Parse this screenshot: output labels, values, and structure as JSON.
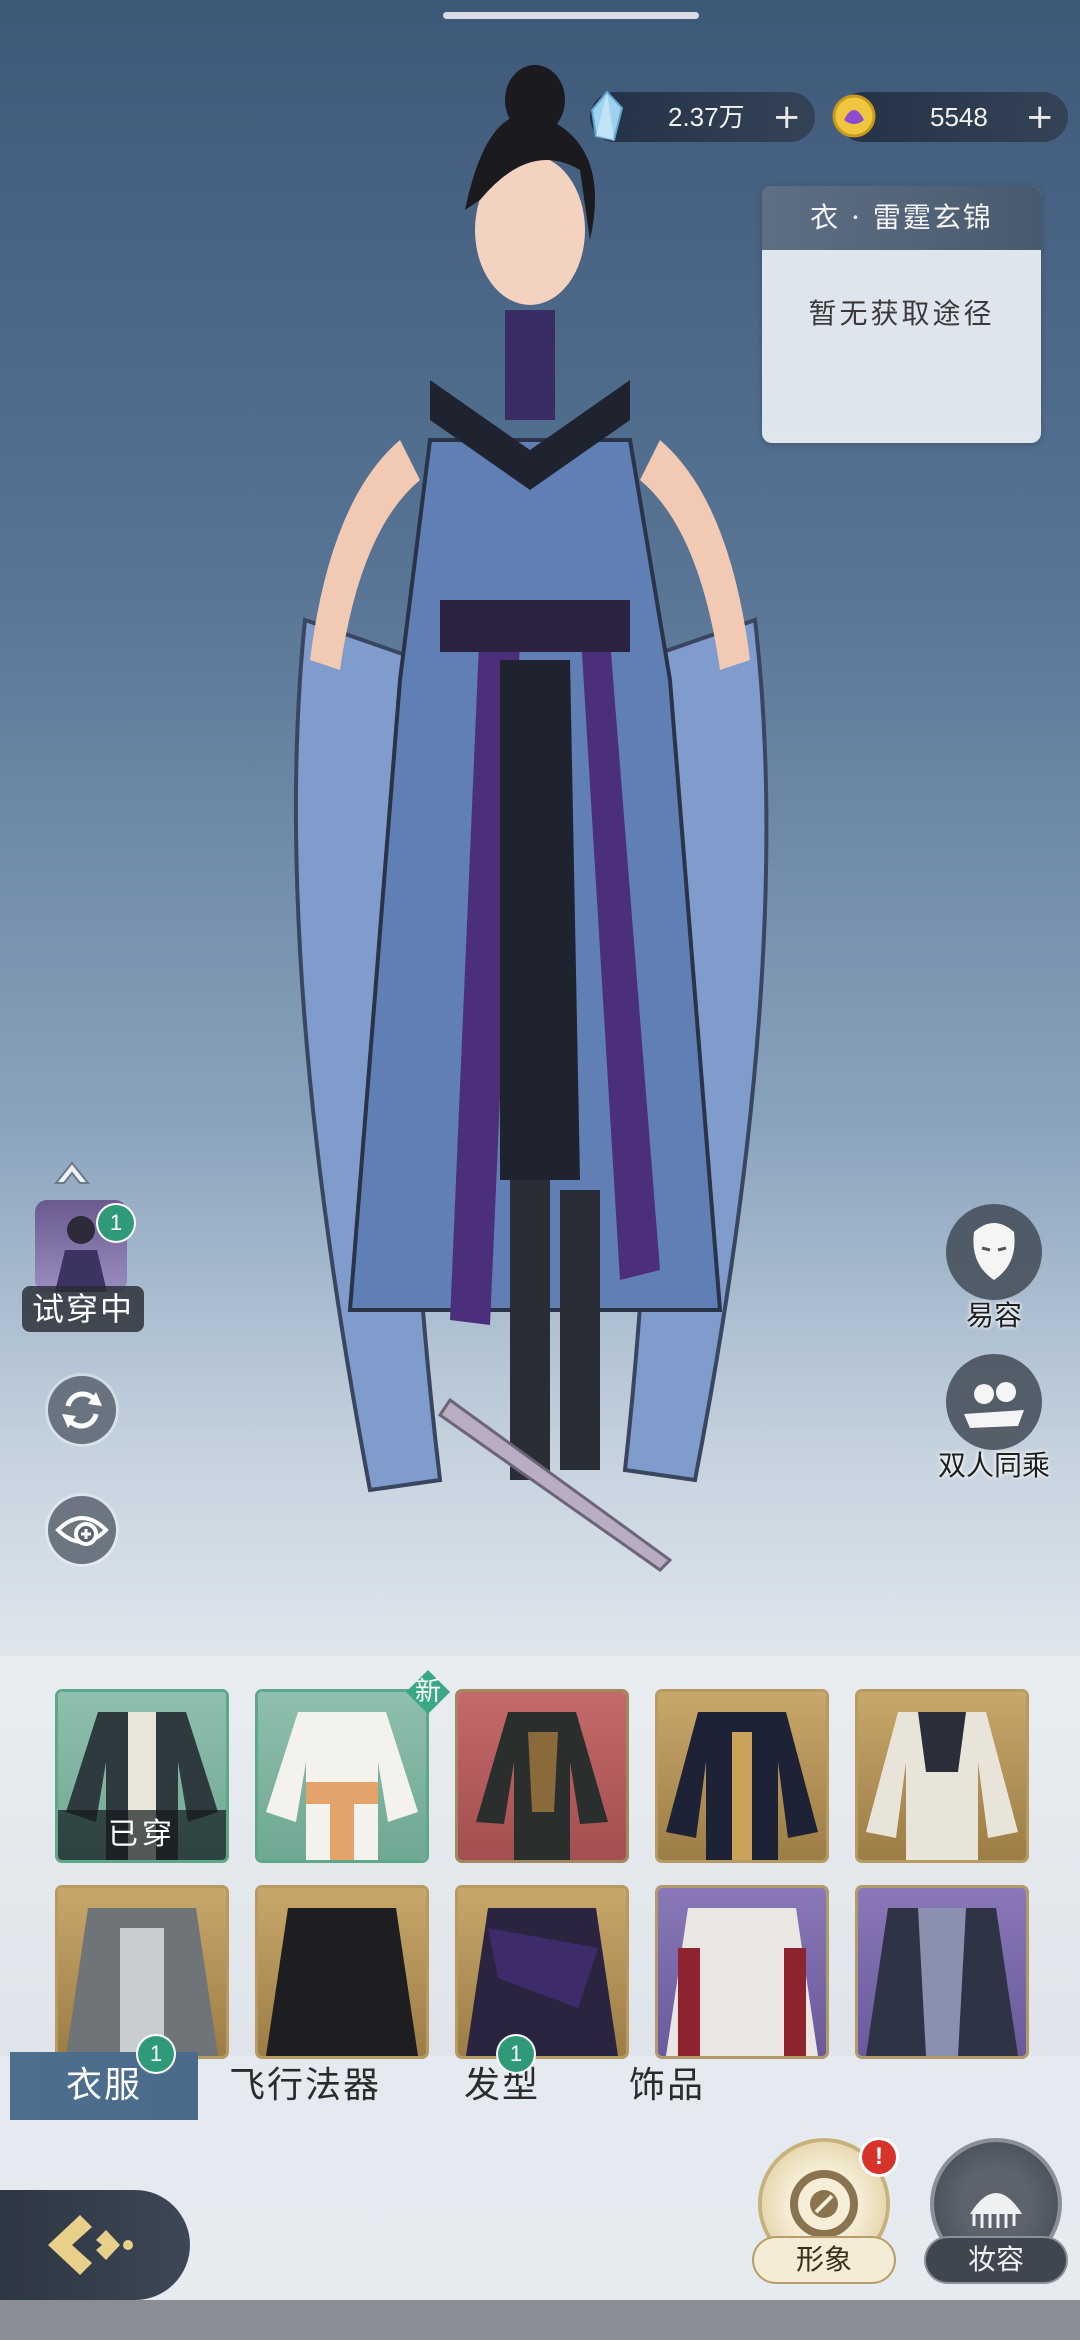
{
  "currencies": [
    {
      "name": "jade-crystal",
      "value": "2.37万"
    },
    {
      "name": "gold-ingot",
      "value": "5548"
    }
  ],
  "item_info": {
    "title": "衣 · 雷霆玄锦",
    "description": "暂无获取途径"
  },
  "try_on": {
    "label": "试穿中",
    "count": "1"
  },
  "side_actions": {
    "disguise": "易容",
    "double_ride": "双人同乘"
  },
  "wardrobe": {
    "worn_label": "已穿",
    "new_label": "新",
    "items": [
      {
        "rarity": "green",
        "state": "worn"
      },
      {
        "rarity": "green",
        "state": "new"
      },
      {
        "rarity": "red",
        "state": ""
      },
      {
        "rarity": "gold",
        "state": ""
      },
      {
        "rarity": "gold",
        "state": ""
      },
      {
        "rarity": "gold",
        "state": ""
      },
      {
        "rarity": "gold",
        "state": ""
      },
      {
        "rarity": "gold",
        "state": ""
      },
      {
        "rarity": "purple",
        "state": ""
      },
      {
        "rarity": "purple",
        "state": ""
      }
    ]
  },
  "tabs": [
    {
      "label": "衣服",
      "badge": "1",
      "active": true
    },
    {
      "label": "飞行法器",
      "badge": "",
      "active": false
    },
    {
      "label": "发型",
      "badge": "1",
      "active": false
    },
    {
      "label": "饰品",
      "badge": "",
      "active": false
    }
  ],
  "bottom_buttons": {
    "appearance": "形象",
    "makeup": "妆容",
    "appearance_alert": "!"
  },
  "colors": {
    "accent_blue": "#4d6f8e",
    "green_badge": "#2e9a78",
    "alert_red": "#d8332b"
  }
}
